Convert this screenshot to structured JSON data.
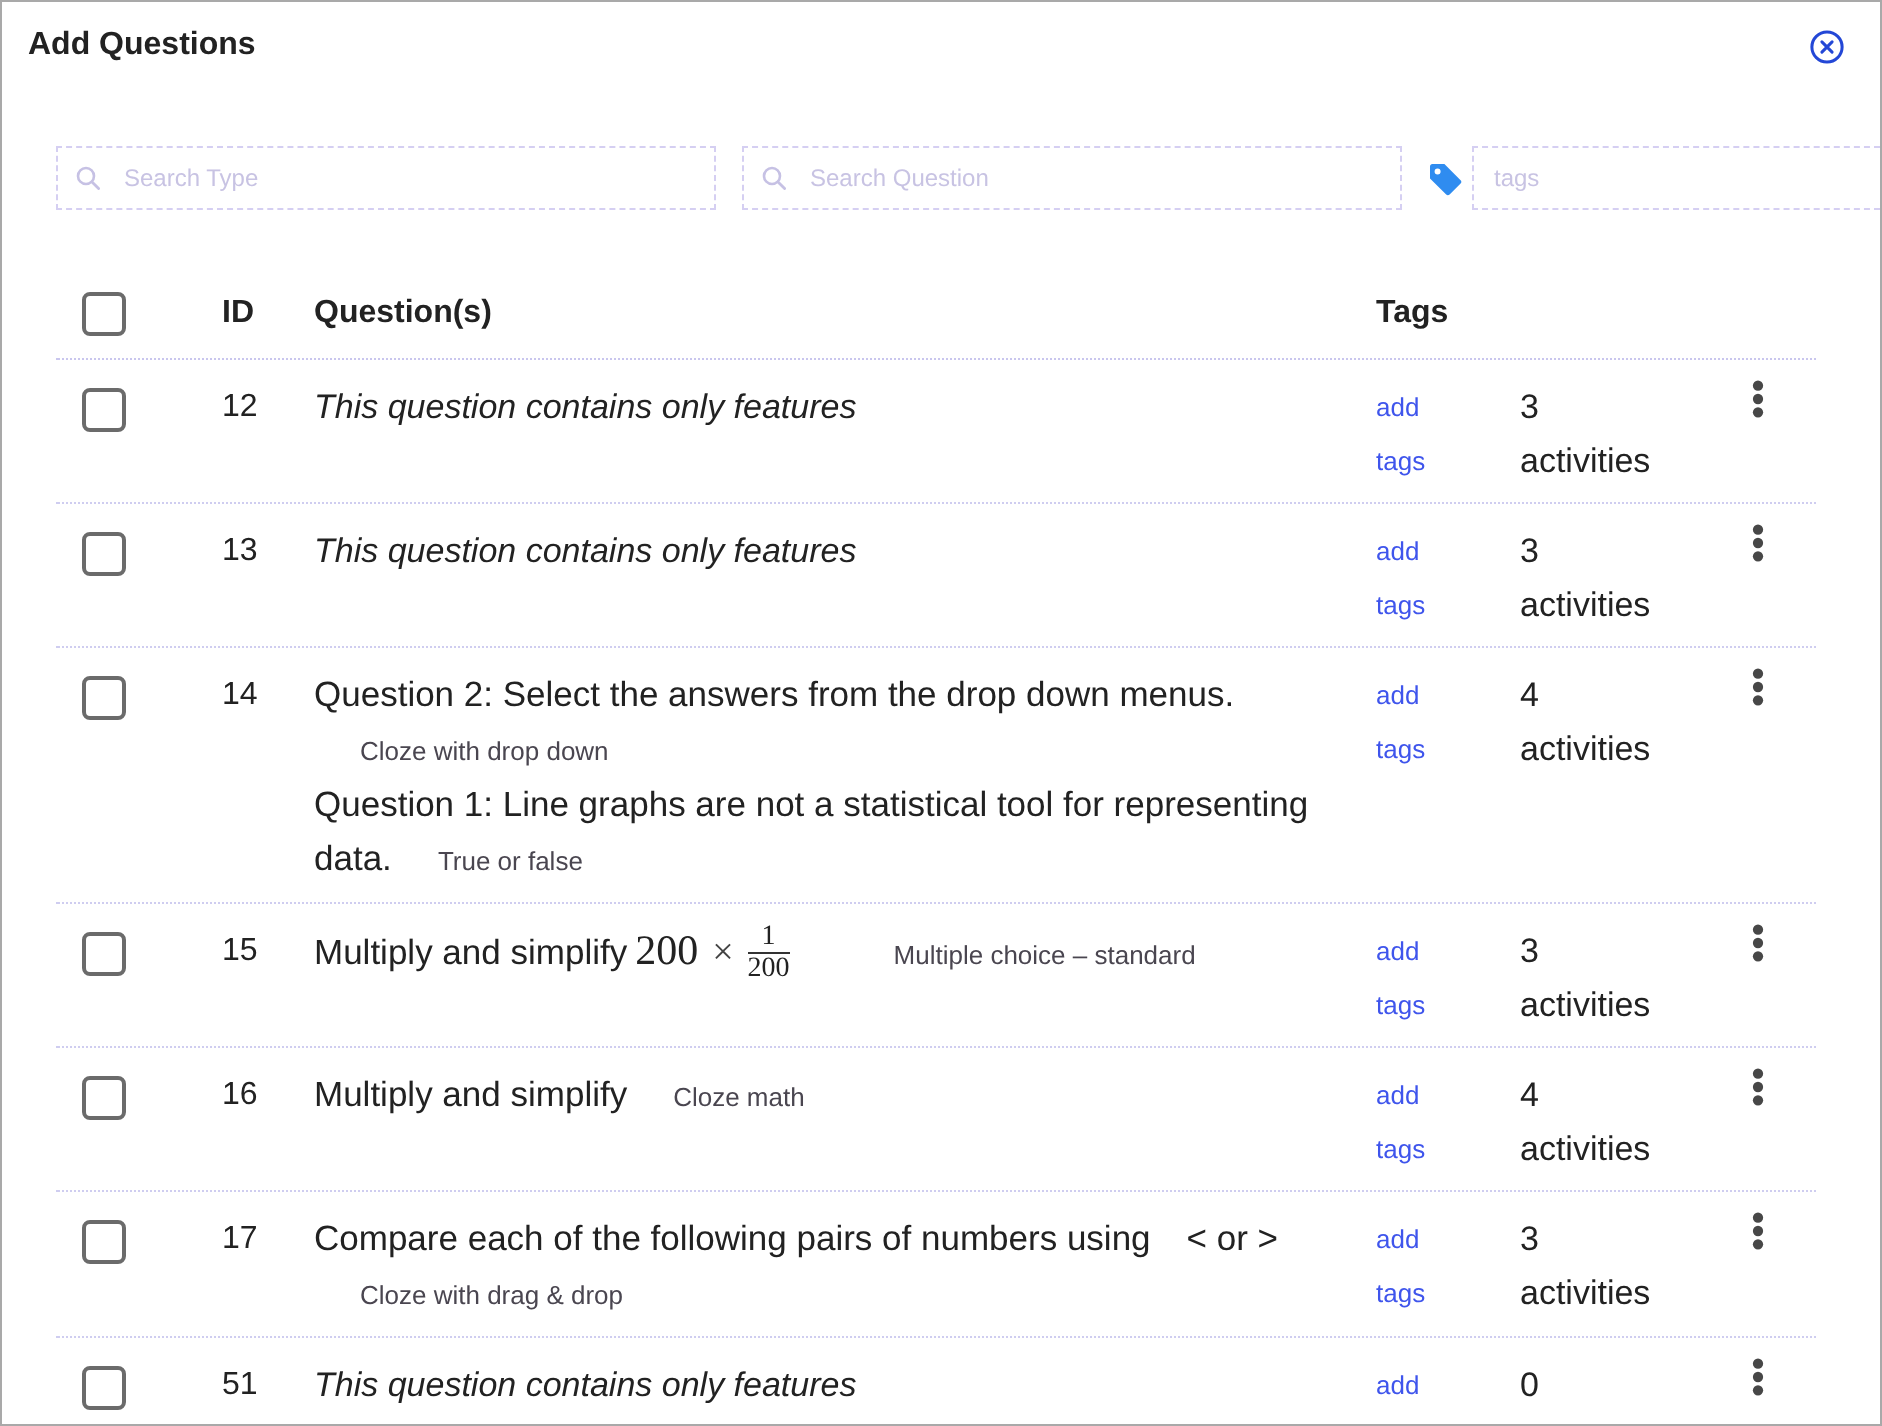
{
  "dialog": {
    "title": "Add Questions"
  },
  "filters": [
    {
      "kind": "search",
      "placeholder": "Search Type"
    },
    {
      "kind": "search",
      "placeholder": "Search Question"
    },
    {
      "kind": "tags",
      "placeholder": "tags"
    }
  ],
  "table": {
    "select_all": {
      "checked": false
    },
    "columns": [
      "ID",
      "Question(s)",
      "Tags"
    ],
    "rows": [
      {
        "id": "12",
        "checked": false,
        "questions": [
          {
            "kind": "features",
            "text": "This question contains only features"
          }
        ],
        "tags_link": "add tags",
        "activities": "3 activities"
      },
      {
        "id": "13",
        "checked": false,
        "questions": [
          {
            "kind": "features",
            "text": "This question contains only features"
          }
        ],
        "tags_link": "add tags",
        "activities": "3 activities"
      },
      {
        "id": "14",
        "checked": false,
        "questions": [
          {
            "kind": "standard",
            "text": "Question 2: Select the answers from the drop down menus.",
            "type": "Cloze with drop down"
          },
          {
            "kind": "standard",
            "text": "Question 1: Line graphs are not a statistical tool for representing data.",
            "type": "True or false"
          }
        ],
        "tags_link": "add tags",
        "activities": "4 activities"
      },
      {
        "id": "15",
        "checked": false,
        "questions": [
          {
            "kind": "standard",
            "text": "Multiply and simplify",
            "math": [
              {
                "kind": "number",
                "text": "200"
              },
              {
                "kind": "operator",
                "text": "×"
              },
              {
                "kind": "fraction",
                "numerator": "1",
                "denominator": "200"
              }
            ],
            "type": "Multiple choice – standard"
          }
        ],
        "tags_link": "add tags",
        "activities": "3 activities"
      },
      {
        "id": "16",
        "checked": false,
        "questions": [
          {
            "kind": "standard",
            "text": "Multiply and simplify",
            "type": "Cloze math"
          }
        ],
        "tags_link": "add tags",
        "activities": "4 activities"
      },
      {
        "id": "17",
        "checked": false,
        "questions": [
          {
            "kind": "standard",
            "text": "Compare each of the following pairs of numbers using",
            "math": [
              {
                "kind": "plain",
                "text": "< or >"
              }
            ],
            "type": "Cloze with drag & drop"
          }
        ],
        "tags_link": "add tags",
        "activities": "3 activities"
      },
      {
        "id": "51",
        "checked": false,
        "questions": [
          {
            "kind": "features",
            "text": "This question contains only features"
          }
        ],
        "tags_link": "add",
        "activities": "0"
      }
    ]
  }
}
